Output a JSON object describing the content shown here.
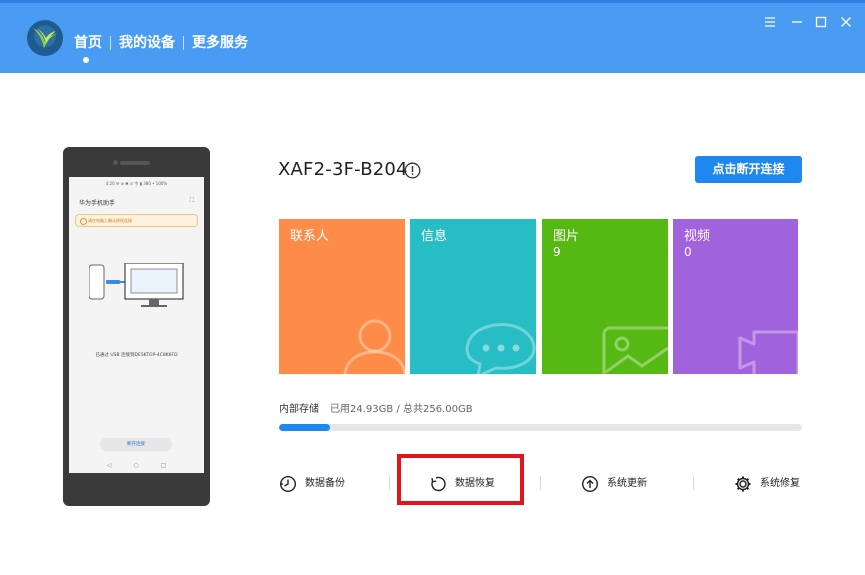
{
  "header": {
    "nav": [
      {
        "label": "首页"
      },
      {
        "label": "我的设备"
      },
      {
        "label": "更多服务"
      }
    ],
    "active_index": 0,
    "window_controls": [
      "menu-icon",
      "minimize-icon",
      "maximize-icon",
      "close-icon"
    ]
  },
  "phone_preview": {
    "status_bar": "4:26 ✉ ⊕                    ✱ ⊙ 令 ▮ 380 • 100%",
    "app_title": "华为手机助手",
    "notice": "请在电脑上确认授权连接",
    "connection_text": "已通过 USB 连接到DESKTOP-4C8K6FD",
    "disconnect_btn": "断开连接",
    "navbar": [
      "◁",
      "○",
      "□"
    ]
  },
  "device": {
    "name": "XAF2-3F-B204",
    "disconnect_label": "点击断开连接"
  },
  "tiles": [
    {
      "label": "联系人",
      "count": "",
      "icon": "contact-icon",
      "color": "#fc8c48"
    },
    {
      "label": "信息",
      "count": "",
      "icon": "message-icon",
      "color": "#26bec4"
    },
    {
      "label": "图片",
      "count": "9",
      "icon": "photo-icon",
      "color": "#56b813"
    },
    {
      "label": "视频",
      "count": "0",
      "icon": "video-icon",
      "color": "#a163db"
    }
  ],
  "storage": {
    "label": "内部存储",
    "value": "已用24.93GB / 总共256.00GB",
    "used_fraction": 0.0974
  },
  "actions": [
    {
      "label": "数据备份",
      "icon": "backup-icon"
    },
    {
      "label": "数据恢复",
      "icon": "restore-icon"
    },
    {
      "label": "系统更新",
      "icon": "update-icon"
    },
    {
      "label": "系统修复",
      "icon": "repair-icon"
    }
  ],
  "colors": {
    "header": "#4a9cf3",
    "accent": "#1e88f0",
    "highlight": "#e4141b"
  }
}
